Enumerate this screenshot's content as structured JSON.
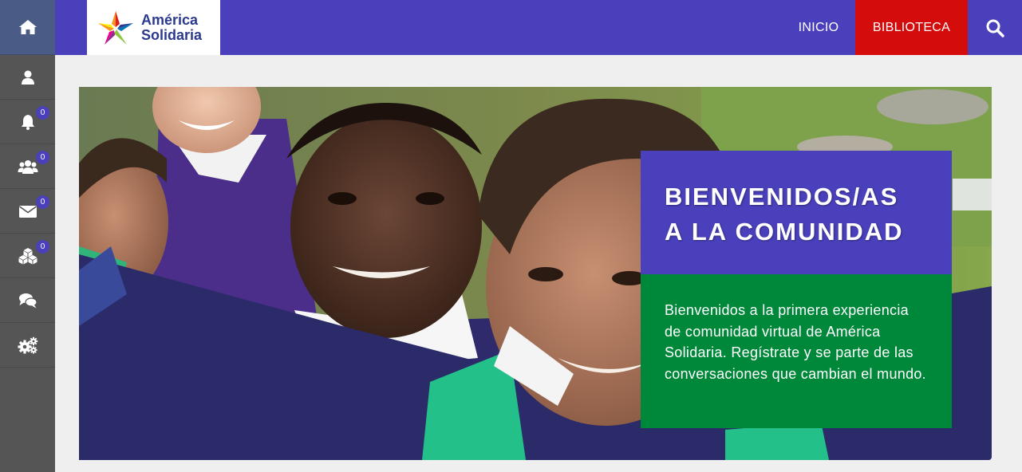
{
  "sidebar": {
    "items": [
      {
        "name": "user-icon",
        "badge": ""
      },
      {
        "name": "bell-icon",
        "badge": "0"
      },
      {
        "name": "users-icon",
        "badge": "0"
      },
      {
        "name": "envelope-icon",
        "badge": "0"
      },
      {
        "name": "cubes-icon",
        "badge": "0"
      },
      {
        "name": "chat-icon",
        "badge": ""
      },
      {
        "name": "gears-icon",
        "badge": ""
      }
    ]
  },
  "header": {
    "logo_line1": "América",
    "logo_line2": "Solidaria",
    "nav": {
      "inicio": "INICIO",
      "biblioteca": "BIBLIOTECA"
    }
  },
  "hero": {
    "title_line1": "BIENVENIDOS/AS",
    "title_line2": "A LA COMUNIDAD",
    "body": "Bienvenidos a la primera experiencia de comunidad virtual de América Solidaria. Regístrate y se parte de las conversaciones que cambian el mundo."
  },
  "colors": {
    "primary": "#4a40bb",
    "active_nav": "#d50c0c",
    "sidebar": "#555555",
    "home": "#4a5b86",
    "green_panel": "#00883a"
  }
}
